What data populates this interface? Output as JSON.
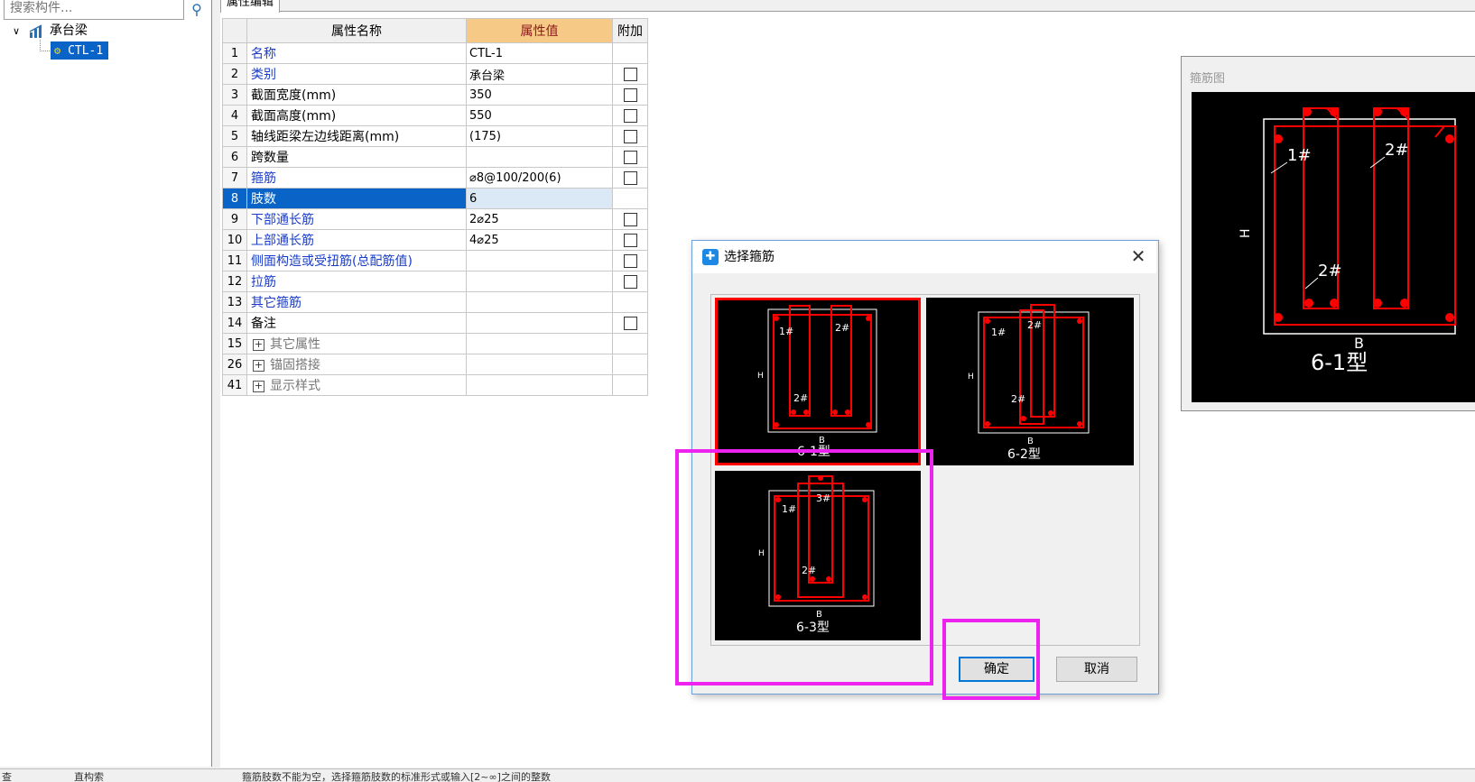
{
  "left_panel": {
    "search_placeholder": "搜索构件...",
    "tree": {
      "root_label": "承台梁",
      "child_label": "CTL-1"
    }
  },
  "property_editor": {
    "tab_label": "属性编辑",
    "headers": {
      "index": "",
      "name": "属性名称",
      "value": "属性值",
      "extra": "附加"
    },
    "rows": [
      {
        "index": "1",
        "name": "名称",
        "value": "CTL-1",
        "blue": true,
        "checkbox": false
      },
      {
        "index": "2",
        "name": "类别",
        "value": "承台梁",
        "blue": true,
        "checkbox": true
      },
      {
        "index": "3",
        "name": "截面宽度(mm)",
        "value": "350",
        "blue": false,
        "checkbox": true
      },
      {
        "index": "4",
        "name": "截面高度(mm)",
        "value": "550",
        "blue": false,
        "checkbox": true
      },
      {
        "index": "5",
        "name": "轴线距梁左边线距离(mm)",
        "value": "(175)",
        "blue": false,
        "checkbox": true
      },
      {
        "index": "6",
        "name": "跨数量",
        "value": "",
        "blue": false,
        "checkbox": true
      },
      {
        "index": "7",
        "name": "箍筋",
        "value": "⌀8@100/200(6)",
        "blue": true,
        "checkbox": true
      },
      {
        "index": "8",
        "name": "肢数",
        "value": "6",
        "blue": true,
        "checkbox": false,
        "selected": true
      },
      {
        "index": "9",
        "name": "下部通长筋",
        "value": "2⌀25",
        "blue": true,
        "checkbox": true
      },
      {
        "index": "10",
        "name": "上部通长筋",
        "value": "4⌀25",
        "blue": true,
        "checkbox": true
      },
      {
        "index": "11",
        "name": "侧面构造或受扭筋(总配筋值)",
        "value": "",
        "blue": true,
        "checkbox": true
      },
      {
        "index": "12",
        "name": "拉筋",
        "value": "",
        "blue": true,
        "checkbox": true
      },
      {
        "index": "13",
        "name": "其它箍筋",
        "value": "",
        "blue": true,
        "checkbox": false
      },
      {
        "index": "14",
        "name": "备注",
        "value": "",
        "blue": false,
        "checkbox": true
      },
      {
        "index": "15",
        "name": "其它属性",
        "value": "",
        "group": true
      },
      {
        "index": "26",
        "name": "锚固搭接",
        "value": "",
        "group": true
      },
      {
        "index": "41",
        "name": "显示样式",
        "value": "",
        "group": true
      }
    ]
  },
  "preview_panel": {
    "title": "箍筋图",
    "label_1": "1#",
    "label_2_top": "2#",
    "label_2_bottom": "2#",
    "dim_h": "H",
    "dim_b": "B",
    "type_label": "6-1型"
  },
  "dialog": {
    "title": "选择箍筋",
    "close_glyph": "✕",
    "options": [
      {
        "type_label": "6-1型",
        "labels": [
          "1#",
          "2#",
          "2#"
        ],
        "selected": true
      },
      {
        "type_label": "6-2型",
        "labels": [
          "1#",
          "2#",
          "2#"
        ],
        "selected": false
      },
      {
        "type_label": "6-3型",
        "labels": [
          "1#",
          "3#",
          "2#"
        ],
        "selected": false
      }
    ],
    "dim_h": "H",
    "dim_b": "B",
    "ok_label": "确定",
    "cancel_label": "取消"
  },
  "status_bar": {
    "segments": [
      "查",
      "直构索",
      "",
      "箍筋肢数不能为空，选择箍筋肢数的标准形式或输入[2~∞]之间的整数"
    ]
  },
  "colors": {
    "selection_blue": "#0a64c8",
    "header_value_bg": "#f7c987",
    "link_blue": "#1a3cc8",
    "rebar_red": "#ff0000",
    "highlight_magenta": "#ee22ee"
  },
  "icons": {
    "search": "search-icon",
    "tree_expand": "chevron-down-icon",
    "tree_root": "beam-icon",
    "tree_child": "gear-icon",
    "dialog": "app-logo-icon",
    "close": "close-icon"
  }
}
